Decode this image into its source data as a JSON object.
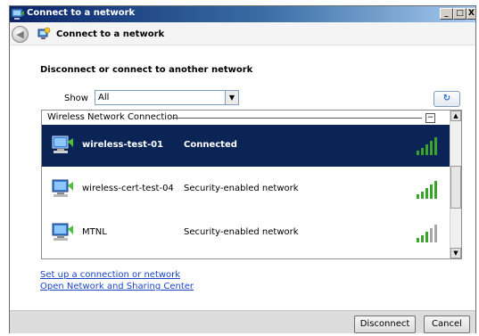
{
  "window": {
    "title": "Connect to a network",
    "minimize": "_",
    "maximize": "□",
    "close": "X"
  },
  "nav": {
    "back_glyph": "◀",
    "title": "Connect to a network"
  },
  "main": {
    "heading": "Disconnect or connect to another network",
    "show_label": "Show",
    "show_value": "All",
    "dropdown_glyph": "▼",
    "refresh_glyph": "↻"
  },
  "network_list": {
    "group_label": "Wireless Network Connection",
    "collapse_glyph": "−",
    "networks": [
      {
        "name": "wireless-test-01",
        "status": "Connected",
        "selected": true,
        "signal_bars_lit": 5
      },
      {
        "name": "wireless-cert-test-04",
        "status": "Security-enabled network",
        "selected": false,
        "signal_bars_lit": 5
      },
      {
        "name": "MTNL",
        "status": "Security-enabled network",
        "selected": false,
        "signal_bars_lit": 3
      }
    ],
    "scroll_up_glyph": "▲",
    "scroll_down_glyph": "▼"
  },
  "links": {
    "setup": "Set up a connection or network",
    "sharing_center": "Open Network and Sharing Center"
  },
  "footer": {
    "disconnect_label": "Disconnect",
    "cancel_label": "Cancel"
  },
  "colors": {
    "selected_row": "#0a2456",
    "signal_on": "#3aa32a",
    "signal_off": "#a8a8a8",
    "link": "#1a46c8"
  }
}
